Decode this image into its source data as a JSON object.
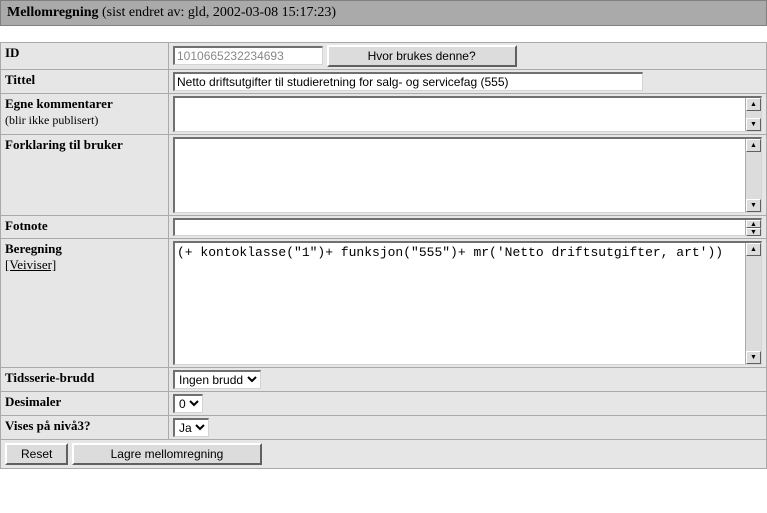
{
  "header": {
    "title": "Mellomregning",
    "meta": "(sist endret av: gld, 2002-03-08 15:17:23)"
  },
  "fields": {
    "id": {
      "label": "ID",
      "value": "1010665232234693",
      "button": "Hvor brukes denne?"
    },
    "tittel": {
      "label": "Tittel",
      "value": "Netto driftsutgifter til studieretning for salg- og servicefag (555)"
    },
    "egne_kommentarer": {
      "label": "Egne kommentarer",
      "sub": "(blir ikke publisert)",
      "value": ""
    },
    "forklaring": {
      "label": "Forklaring til bruker",
      "value": ""
    },
    "fotnote": {
      "label": "Fotnote",
      "value": ""
    },
    "beregning": {
      "label": "Beregning",
      "link": "[Veiviser]",
      "value": "(+ kontoklasse(\"1\")+ funksjon(\"555\")+ mr('Netto driftsutgifter, art'))"
    },
    "tidsserie": {
      "label": "Tidsserie-brudd",
      "selected": "Ingen brudd"
    },
    "desimaler": {
      "label": "Desimaler",
      "selected": "0"
    },
    "niva3": {
      "label": "Vises på nivå3?",
      "selected": "Ja"
    }
  },
  "buttons": {
    "reset": "Reset",
    "lagre": "Lagre mellomregning"
  }
}
